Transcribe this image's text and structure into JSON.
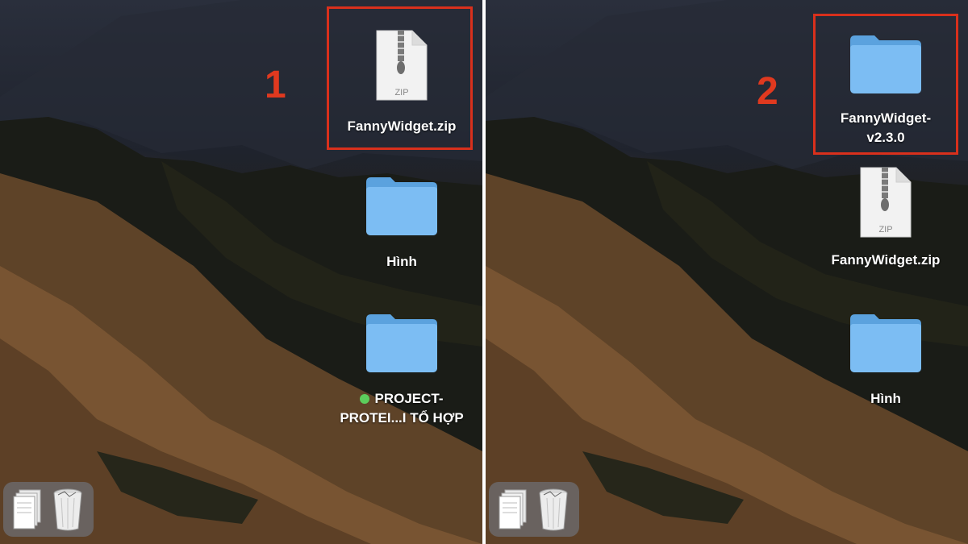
{
  "left_panel": {
    "step_number": "1",
    "items": [
      {
        "label": "FannyWidget.zip",
        "icon": "zip-file-icon",
        "zip_tag": "ZIP"
      },
      {
        "label": "Hình",
        "icon": "folder-icon"
      },
      {
        "label_line1": "PROJECT-",
        "label_line2": "PROTEI...I TỔ HỢP",
        "icon": "folder-icon",
        "tag_color": "#5ccd5c"
      }
    ]
  },
  "right_panel": {
    "step_number": "2",
    "items": [
      {
        "label_line1": "FannyWidget-",
        "label_line2": "v2.3.0",
        "icon": "folder-icon"
      },
      {
        "label": "FannyWidget.zip",
        "icon": "zip-file-icon",
        "zip_tag": "ZIP"
      },
      {
        "label": "Hình",
        "icon": "folder-icon"
      }
    ]
  },
  "dock": {
    "items": [
      {
        "icon": "documents-stack-icon"
      },
      {
        "icon": "trash-icon"
      }
    ]
  },
  "colors": {
    "highlight": "#d9301c",
    "step_number": "#e0391f",
    "folder": "#6ab3ee",
    "tag_green": "#5ccd5c"
  }
}
